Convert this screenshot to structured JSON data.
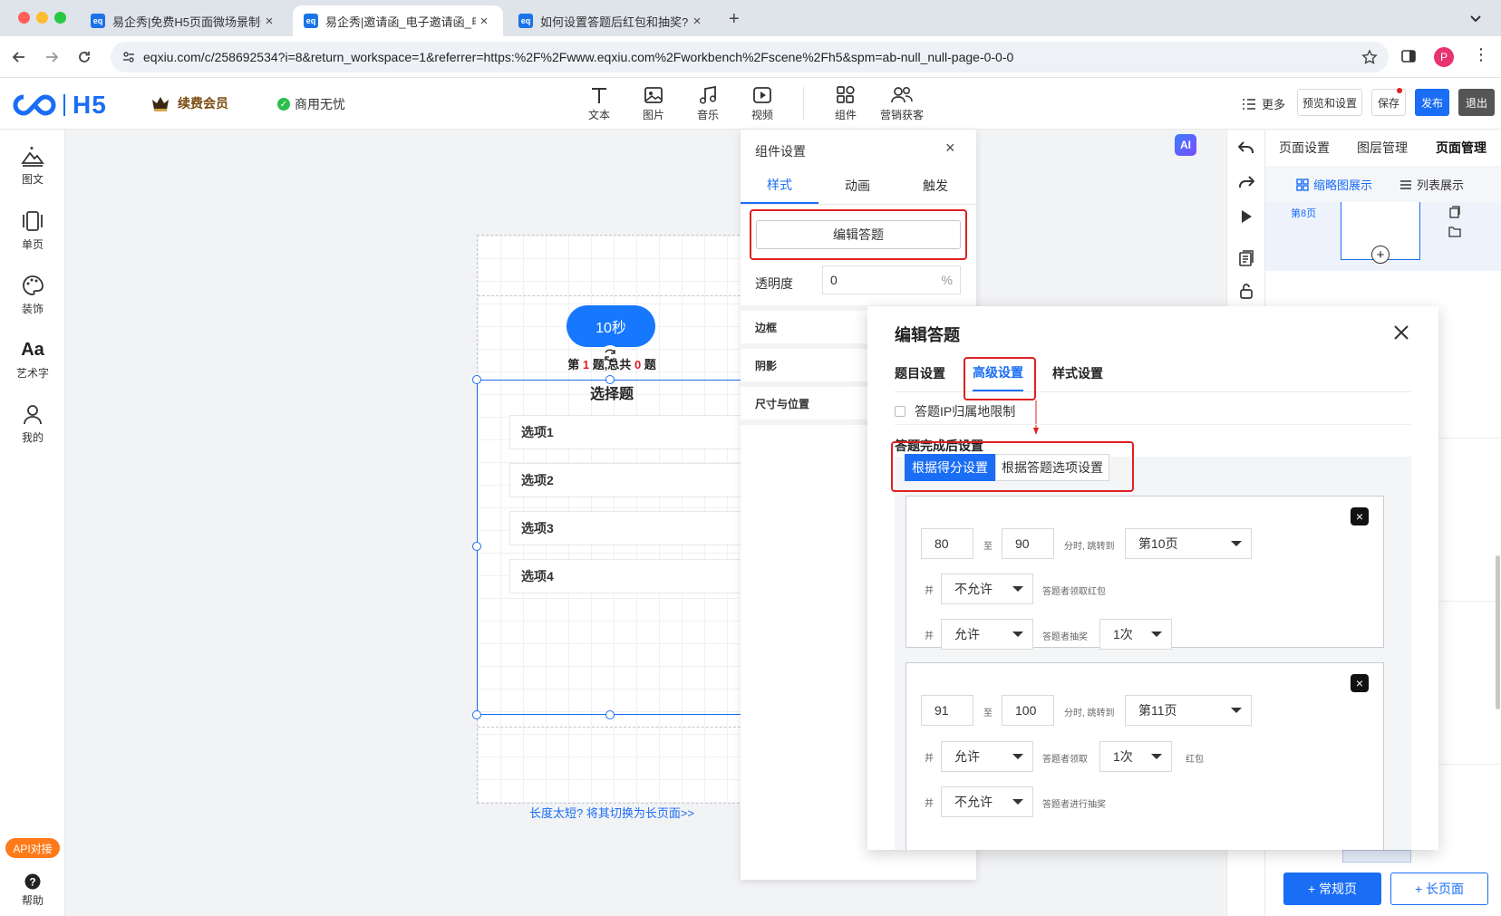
{
  "browser": {
    "tabs": [
      {
        "title": "易企秀|免费H5页面微场景制作"
      },
      {
        "title": "易企秀|邀请函_电子邀请函_电"
      },
      {
        "title": "如何设置答题后红包和抽奖? -"
      }
    ],
    "url": "eqxiu.com/c/258692534?i=8&return_workspace=1&referrer=https:%2F%2Fwww.eqxiu.com%2Fworkbench%2Fscene%2Fh5&spm=ab-null_null-page-0-0-0",
    "profile_initial": "P",
    "favicon_text": "eq"
  },
  "header": {
    "logo": "H5",
    "vip": "续费会员",
    "commercial": "商用无忧",
    "tools": [
      "文本",
      "图片",
      "音乐",
      "视频",
      "组件",
      "营销获客"
    ],
    "more": "更多",
    "preview": "预览和设置",
    "save": "保存",
    "publish": "发布",
    "exit": "退出"
  },
  "sidebar": {
    "items": [
      "图文",
      "单页",
      "装饰",
      "艺术字",
      "我的"
    ],
    "api": "API对接",
    "help": "帮助"
  },
  "canvas": {
    "timer": "10秒",
    "progress_pre": "第",
    "progress_current": "1",
    "progress_mid": "题,总共",
    "progress_total": "0",
    "progress_post": "题",
    "question": "选择题",
    "options": [
      "选项1",
      "选项2",
      "选项3",
      "选项4"
    ],
    "switch_link": "长度太短? 将其切换为长页面>>",
    "ai_badge": "AI"
  },
  "component_panel": {
    "title": "组件设置",
    "tabs": [
      "样式",
      "动画",
      "触发"
    ],
    "edit_button": "编辑答题",
    "opacity_label": "透明度",
    "opacity_value": "0",
    "opacity_unit": "%",
    "sections": [
      "边框",
      "阴影",
      "尺寸与位置"
    ]
  },
  "right_panel": {
    "tabs": [
      "页面设置",
      "图层管理",
      "页面管理"
    ],
    "views": [
      "缩略图展示",
      "列表展示"
    ],
    "page_label": "第8页",
    "add_normal": "+ 常规页",
    "add_long": "+ 长页面"
  },
  "modal": {
    "title": "编辑答题",
    "tabs": [
      "题目设置",
      "高级设置",
      "样式设置"
    ],
    "ip_limit": "答题IP归属地限制",
    "after_title": "答题完成后设置",
    "mode_tabs": [
      "根据得分设置",
      "根据答题选项设置"
    ],
    "rules": [
      {
        "from": "80",
        "to_label": "至",
        "to": "90",
        "jump_label": "分时, 跳转到",
        "page": "第10页",
        "rows": [
          {
            "and": "并",
            "value": "不允许",
            "desc": "答题者领取红包"
          },
          {
            "and": "并",
            "value": "允许",
            "desc": "答题者抽奖",
            "times": "1次"
          }
        ]
      },
      {
        "from": "91",
        "to_label": "至",
        "to": "100",
        "jump_label": "分时, 跳转到",
        "page": "第11页",
        "rows": [
          {
            "and": "并",
            "value": "允许",
            "desc": "答题者领取",
            "times": "1次",
            "suffix": "红包"
          },
          {
            "and": "并",
            "value": "不允许",
            "desc": "答题者进行抽奖"
          }
        ]
      }
    ]
  },
  "colors": {
    "accent": "#1a6df5",
    "highlight": "#e02020",
    "timer": "#1677ff"
  }
}
